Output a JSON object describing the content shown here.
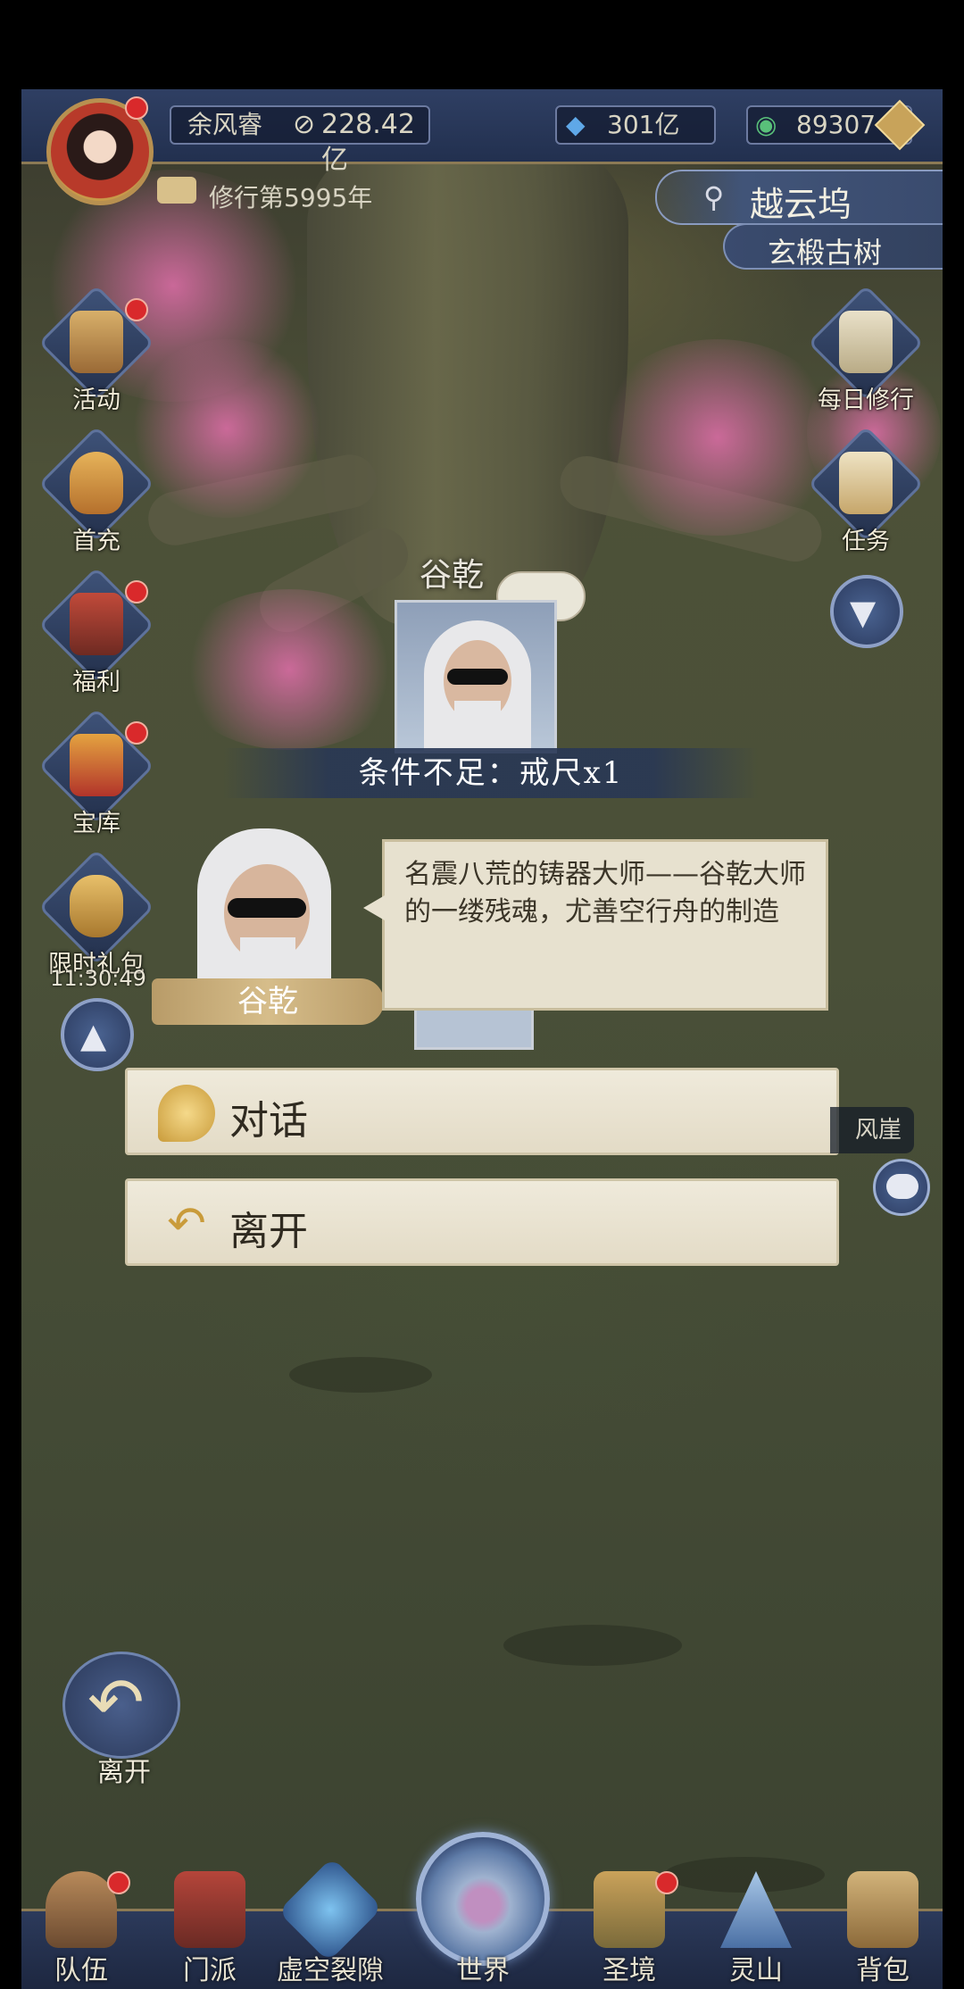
{
  "player": {
    "name": "余风睿",
    "power": "228.42亿",
    "cultivation_year": "修行第5995年"
  },
  "resources": {
    "spirit_stones": "301亿",
    "jade": "89307"
  },
  "location": {
    "region": "越云坞",
    "spot": "玄椴古树"
  },
  "left_menu": [
    {
      "label": "活动",
      "icon": "lantern-icon"
    },
    {
      "label": "首充",
      "icon": "gift-bag-icon"
    },
    {
      "label": "福利",
      "icon": "pavilion-icon"
    },
    {
      "label": "宝库",
      "icon": "treasure-chest-icon"
    },
    {
      "label": "限时礼包",
      "icon": "money-bag-icon"
    }
  ],
  "limited_timer": "11:30:49",
  "right_menu": [
    {
      "label": "每日修行",
      "icon": "scroll-book-icon"
    },
    {
      "label": "任务",
      "icon": "quest-scroll-icon"
    }
  ],
  "npc": {
    "name": "谷乾",
    "condition": "条件不足：戒尺x1"
  },
  "dialog": {
    "speaker": "谷乾",
    "text": "名震八荒的铸器大师——谷乾大师的一缕残魂，尤善空行舟的制造",
    "options": [
      {
        "label": "对话",
        "icon": "talk-icon"
      },
      {
        "label": "离开",
        "icon": "return-arrow-icon"
      }
    ]
  },
  "map_label_partial": "风崖",
  "leave_button": "离开",
  "bottom_nav": [
    {
      "label": "队伍"
    },
    {
      "label": "门派"
    },
    {
      "label": "虚空裂隙"
    },
    {
      "label": "世界"
    },
    {
      "label": "圣境"
    },
    {
      "label": "灵山"
    },
    {
      "label": "背包"
    }
  ],
  "colors": {
    "topbar": "#2a3858",
    "gold_border": "#8c7a55",
    "dialog_bg": "#e7e1cf",
    "notify_red": "#d9292b"
  }
}
